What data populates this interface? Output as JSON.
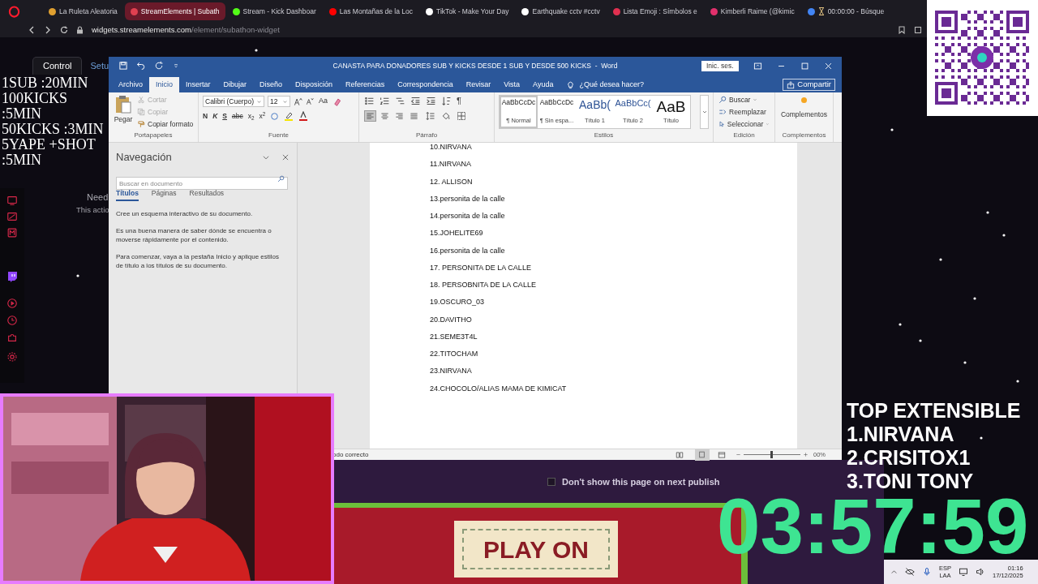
{
  "browser": {
    "tabs": [
      {
        "label": "La Ruleta Aleatoria",
        "color": "#e0a030",
        "selected": false
      },
      {
        "label": "StreamElements | Subath",
        "color": "#e04050",
        "selected": true
      },
      {
        "label": "Stream - Kick Dashboar",
        "color": "#53fc18",
        "selected": false
      },
      {
        "label": "Las Montañas de la Loc",
        "color": "#ff0000",
        "selected": false
      },
      {
        "label": "TikTok - Make Your Day",
        "color": "#ffffff",
        "selected": false
      },
      {
        "label": "Earthquake cctv #cctv",
        "color": "#ffffff",
        "selected": false
      },
      {
        "label": "Lista Emoji : Símbolos e",
        "color": "#e03050",
        "selected": false
      },
      {
        "label": "Kimberli Raime (@kimic",
        "color": "#e1306c",
        "selected": false
      },
      {
        "label": "00:00:00 - Búsque",
        "color": "#4285f4",
        "selected": false,
        "kind": "timer"
      }
    ],
    "url_host": "widgets.streamelements.com",
    "url_path": "/element/subathon-widget"
  },
  "streamelements": {
    "tabs": [
      {
        "label": "Control",
        "selected": true
      },
      {
        "label": "Setu",
        "selected": false
      }
    ],
    "notice_title": "Need",
    "notice_text": "This actio"
  },
  "subathon_rules": [
    "1SUB :20MIN",
    "100KICKS :5MIN",
    "50KICKS :3MIN",
    "5YAPE +SHOT :5MIN"
  ],
  "word": {
    "title": "CANASTA PARA DONADORES SUB Y KICKS DESDE 1 SUB Y DESDE 500 KICKS  -  Word",
    "sign_in": "Inic. ses.",
    "tabs": [
      {
        "label": "Archivo",
        "selected": false
      },
      {
        "label": "Inicio",
        "selected": true
      },
      {
        "label": "Insertar",
        "selected": false
      },
      {
        "label": "Dibujar",
        "selected": false
      },
      {
        "label": "Diseño",
        "selected": false
      },
      {
        "label": "Disposición",
        "selected": false
      },
      {
        "label": "Referencias",
        "selected": false
      },
      {
        "label": "Correspondencia",
        "selected": false
      },
      {
        "label": "Revisar",
        "selected": false
      },
      {
        "label": "Vista",
        "selected": false
      },
      {
        "label": "Ayuda",
        "selected": false
      }
    ],
    "tell_me": "¿Qué desea hacer?",
    "share": "Compartir",
    "clipboard": {
      "paste": "Pegar",
      "actions": [
        {
          "label": "Cortar",
          "disabled": true
        },
        {
          "label": "Copiar",
          "disabled": true
        },
        {
          "label": "Copiar formato",
          "disabled": false
        }
      ],
      "group": "Portapapeles"
    },
    "font": {
      "family": "Calibri (Cuerpo)",
      "size_box": "12",
      "case_label": "Aa",
      "format_buttons": [
        "N",
        "K",
        "S",
        "abc",
        "x$_{2}$",
        "x$^{2}$"
      ],
      "group": "Fuente"
    },
    "paragraph": {
      "pilcrow": "¶",
      "alignment": [
        {
          "kind": "left",
          "selected": true
        },
        {
          "kind": "center",
          "selected": false
        },
        {
          "kind": "right",
          "selected": false
        },
        {
          "kind": "justify",
          "selected": false
        }
      ],
      "group": "Párrafo"
    },
    "styles": {
      "items": [
        {
          "preview": "AaBbCcDc",
          "name": "¶ Normal",
          "kind": "body",
          "selected": true
        },
        {
          "preview": "AaBbCcDc",
          "name": "¶ Sin espa...",
          "kind": "body",
          "selected": false
        },
        {
          "preview": "AaBb(",
          "name": "Título 1",
          "kind": "heading1",
          "selected": false
        },
        {
          "preview": "AaBbCc(",
          "name": "Título 2",
          "kind": "heading2",
          "selected": false
        },
        {
          "preview": "AaB",
          "name": "Título",
          "kind": "title",
          "selected": false
        }
      ],
      "group": "Estilos"
    },
    "editing": {
      "items": [
        {
          "kind": "find",
          "label": "Buscar"
        },
        {
          "kind": "replace",
          "label": "Reemplazar"
        },
        {
          "kind": "select",
          "label": "Seleccionar"
        }
      ],
      "group": "Edición"
    },
    "addins": {
      "label": "Complementos",
      "group": "Complementos"
    },
    "navigation": {
      "title": "Navegación",
      "placeholder": "Buscar en documento",
      "tabs": [
        {
          "label": "Títulos",
          "selected": true
        },
        {
          "label": "Páginas",
          "selected": false
        },
        {
          "label": "Resultados",
          "selected": false
        }
      ],
      "paragraphs": [
        "Cree un esquema interactivo de su documento.",
        "Es una buena manera de saber dónde se encuentra o moverse rápidamente por el contenido.",
        "Para comenzar, vaya a la pestaña Inicio y aplique estilos de título a los títulos de su documento."
      ]
    },
    "lines": [
      "10.NIRVANA",
      "11.NIRVANA",
      "12. ALLISON",
      "13.personita de la calle",
      "14.personita de la calle",
      "15.JOHELITE69",
      "16.personita de la calle",
      "17. PERSONITA DE LA CALLE",
      "18. PERSOBNITA DE LA CALLE",
      "19.OSCURO_03",
      "20.DAVITHO",
      "21.SEME3T4L",
      "22.TITOCHAM",
      "23.NIRVANA",
      "24.CHOCOLO/ALIAS MAMA DE KIMICAT"
    ],
    "status": "odo correcto",
    "zoom_slider": {
      "level": 0.5
    },
    "zoom": "00%"
  },
  "promo": {
    "checkbox": {
      "label": "Don't show this page on next publish",
      "checked": false
    },
    "banner": "PLAY ON"
  },
  "leaderboard": {
    "title": "TOP EXTENSIBLE",
    "entries": [
      "1.NIRVANA",
      "2.CRISITOX1",
      "3.TONI TONY"
    ]
  },
  "timer": "03:57:59",
  "taskbar": {
    "language": "ESP",
    "layout": "LAA",
    "time": "01:16",
    "date": "17/12/2025"
  }
}
